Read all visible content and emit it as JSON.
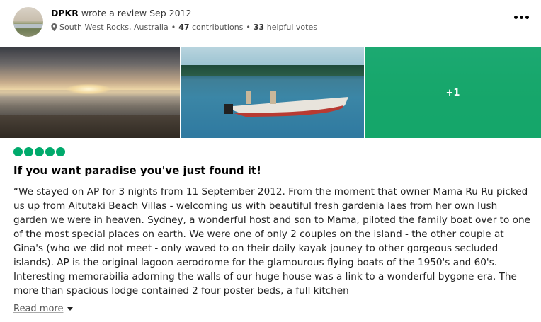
{
  "review": {
    "user": "DPKR",
    "action": "wrote a review Sep 2012",
    "location": "South West Rocks, Australia",
    "contributions_count": "47",
    "contributions_label": "contributions",
    "helpful_count": "33",
    "helpful_label": "helpful votes",
    "rating": 5,
    "rating_max": 5,
    "title": "If you want paradise you've just found it!",
    "body": "“We stayed on AP for 3 nights from 11 September 2012. From the moment that owner Mama Ru Ru picked us up from Aitutaki Beach Villas - welcoming us with beautiful fresh gardenia laes from her own lush garden we were in heaven. Sydney, a wonderful host and son to Mama, piloted the family boat over to one of the most special places on earth. We were one of only 2 couples on the island - the other couple at Gina's (who we did not meet - only waved to on their daily kayak jouney to other gorgeous secluded islands). AP is the original lagoon aerodrome for the glamourous flying boats of the 1950's and 60's. Interesting memorabilia adorning the walls of our huge house was a link to a wonderful bygone era. The more than spacious lodge contained 2 four poster beds, a full kitchen",
    "read_more": "Read more",
    "extra_photos": "+1"
  },
  "colors": {
    "rating_bubble": "#00aa6c",
    "overlay_green": "#00aa6c"
  },
  "icons": {
    "more": "more-horizontal-icon",
    "pin": "map-pin-icon",
    "caret": "chevron-down-icon"
  }
}
